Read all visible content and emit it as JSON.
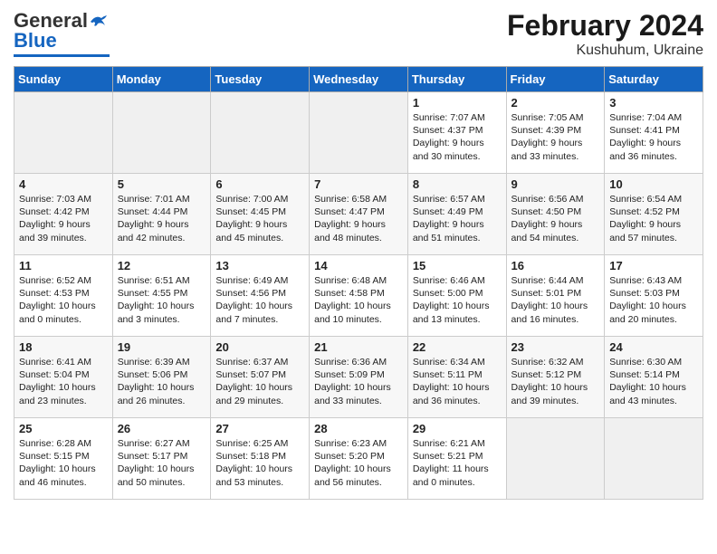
{
  "logo": {
    "general": "General",
    "blue": "Blue"
  },
  "title": "February 2024",
  "subtitle": "Kushuhum, Ukraine",
  "days_of_week": [
    "Sunday",
    "Monday",
    "Tuesday",
    "Wednesday",
    "Thursday",
    "Friday",
    "Saturday"
  ],
  "weeks": [
    [
      {
        "day": "",
        "info": ""
      },
      {
        "day": "",
        "info": ""
      },
      {
        "day": "",
        "info": ""
      },
      {
        "day": "",
        "info": ""
      },
      {
        "day": "1",
        "info": "Sunrise: 7:07 AM\nSunset: 4:37 PM\nDaylight: 9 hours\nand 30 minutes."
      },
      {
        "day": "2",
        "info": "Sunrise: 7:05 AM\nSunset: 4:39 PM\nDaylight: 9 hours\nand 33 minutes."
      },
      {
        "day": "3",
        "info": "Sunrise: 7:04 AM\nSunset: 4:41 PM\nDaylight: 9 hours\nand 36 minutes."
      }
    ],
    [
      {
        "day": "4",
        "info": "Sunrise: 7:03 AM\nSunset: 4:42 PM\nDaylight: 9 hours\nand 39 minutes."
      },
      {
        "day": "5",
        "info": "Sunrise: 7:01 AM\nSunset: 4:44 PM\nDaylight: 9 hours\nand 42 minutes."
      },
      {
        "day": "6",
        "info": "Sunrise: 7:00 AM\nSunset: 4:45 PM\nDaylight: 9 hours\nand 45 minutes."
      },
      {
        "day": "7",
        "info": "Sunrise: 6:58 AM\nSunset: 4:47 PM\nDaylight: 9 hours\nand 48 minutes."
      },
      {
        "day": "8",
        "info": "Sunrise: 6:57 AM\nSunset: 4:49 PM\nDaylight: 9 hours\nand 51 minutes."
      },
      {
        "day": "9",
        "info": "Sunrise: 6:56 AM\nSunset: 4:50 PM\nDaylight: 9 hours\nand 54 minutes."
      },
      {
        "day": "10",
        "info": "Sunrise: 6:54 AM\nSunset: 4:52 PM\nDaylight: 9 hours\nand 57 minutes."
      }
    ],
    [
      {
        "day": "11",
        "info": "Sunrise: 6:52 AM\nSunset: 4:53 PM\nDaylight: 10 hours\nand 0 minutes."
      },
      {
        "day": "12",
        "info": "Sunrise: 6:51 AM\nSunset: 4:55 PM\nDaylight: 10 hours\nand 3 minutes."
      },
      {
        "day": "13",
        "info": "Sunrise: 6:49 AM\nSunset: 4:56 PM\nDaylight: 10 hours\nand 7 minutes."
      },
      {
        "day": "14",
        "info": "Sunrise: 6:48 AM\nSunset: 4:58 PM\nDaylight: 10 hours\nand 10 minutes."
      },
      {
        "day": "15",
        "info": "Sunrise: 6:46 AM\nSunset: 5:00 PM\nDaylight: 10 hours\nand 13 minutes."
      },
      {
        "day": "16",
        "info": "Sunrise: 6:44 AM\nSunset: 5:01 PM\nDaylight: 10 hours\nand 16 minutes."
      },
      {
        "day": "17",
        "info": "Sunrise: 6:43 AM\nSunset: 5:03 PM\nDaylight: 10 hours\nand 20 minutes."
      }
    ],
    [
      {
        "day": "18",
        "info": "Sunrise: 6:41 AM\nSunset: 5:04 PM\nDaylight: 10 hours\nand 23 minutes."
      },
      {
        "day": "19",
        "info": "Sunrise: 6:39 AM\nSunset: 5:06 PM\nDaylight: 10 hours\nand 26 minutes."
      },
      {
        "day": "20",
        "info": "Sunrise: 6:37 AM\nSunset: 5:07 PM\nDaylight: 10 hours\nand 29 minutes."
      },
      {
        "day": "21",
        "info": "Sunrise: 6:36 AM\nSunset: 5:09 PM\nDaylight: 10 hours\nand 33 minutes."
      },
      {
        "day": "22",
        "info": "Sunrise: 6:34 AM\nSunset: 5:11 PM\nDaylight: 10 hours\nand 36 minutes."
      },
      {
        "day": "23",
        "info": "Sunrise: 6:32 AM\nSunset: 5:12 PM\nDaylight: 10 hours\nand 39 minutes."
      },
      {
        "day": "24",
        "info": "Sunrise: 6:30 AM\nSunset: 5:14 PM\nDaylight: 10 hours\nand 43 minutes."
      }
    ],
    [
      {
        "day": "25",
        "info": "Sunrise: 6:28 AM\nSunset: 5:15 PM\nDaylight: 10 hours\nand 46 minutes."
      },
      {
        "day": "26",
        "info": "Sunrise: 6:27 AM\nSunset: 5:17 PM\nDaylight: 10 hours\nand 50 minutes."
      },
      {
        "day": "27",
        "info": "Sunrise: 6:25 AM\nSunset: 5:18 PM\nDaylight: 10 hours\nand 53 minutes."
      },
      {
        "day": "28",
        "info": "Sunrise: 6:23 AM\nSunset: 5:20 PM\nDaylight: 10 hours\nand 56 minutes."
      },
      {
        "day": "29",
        "info": "Sunrise: 6:21 AM\nSunset: 5:21 PM\nDaylight: 11 hours\nand 0 minutes."
      },
      {
        "day": "",
        "info": ""
      },
      {
        "day": "",
        "info": ""
      }
    ]
  ]
}
